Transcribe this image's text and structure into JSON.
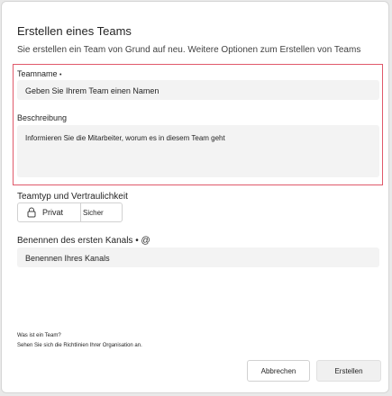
{
  "dialog": {
    "title": "Erstellen eines Teams",
    "subtitle": "Sie erstellen ein Team von Grund auf neu. Weitere Optionen zum Erstellen von Teams"
  },
  "team_name": {
    "label": "Teamname",
    "required_marker": "•",
    "placeholder": "Geben Sie Ihrem Team einen Namen"
  },
  "description": {
    "label": "Beschreibung",
    "placeholder": "Informieren Sie die Mitarbeiter, worum es in diesem Team geht"
  },
  "privacy": {
    "label": "Teamtyp und Vertraulichkeit",
    "options": [
      "Privat",
      "Sicher"
    ],
    "selected": "Privat"
  },
  "first_channel": {
    "label": "Benennen des ersten Kanals • @",
    "placeholder": "Benennen Ihres Kanals"
  },
  "footer": {
    "help_link": "Was ist ein Team?",
    "policy_text": "Sehen Sie sich die Richtlinien Ihrer Organisation an."
  },
  "buttons": {
    "cancel": "Abbrechen",
    "create": "Erstellen"
  },
  "colors": {
    "highlight_border": "#e0596a",
    "field_bg": "#f3f3f3"
  }
}
